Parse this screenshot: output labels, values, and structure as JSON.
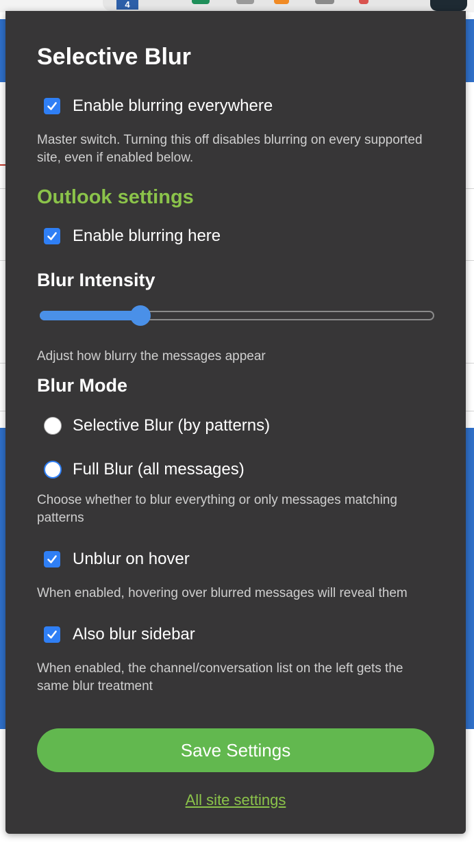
{
  "toolbar": {
    "badge_count": "4"
  },
  "popup": {
    "title": "Selective Blur",
    "global": {
      "enable_everywhere_label": "Enable blurring everywhere",
      "enable_everywhere_checked": true,
      "master_help": "Master switch. Turning this off disables blurring on every supported site, even if enabled below."
    },
    "site": {
      "section_title": "Outlook settings",
      "enable_here_label": "Enable blurring here",
      "enable_here_checked": true,
      "intensity_title": "Blur Intensity",
      "intensity_value": 0.23,
      "intensity_help": "Adjust how blurry the messages appear",
      "mode_title": "Blur Mode",
      "modes": [
        {
          "label": "Selective Blur (by patterns)",
          "selected": false
        },
        {
          "label": "Full Blur (all messages)",
          "selected": true
        }
      ],
      "mode_help": "Choose whether to blur everything or only messages matching patterns",
      "unblur_hover_label": "Unblur on hover",
      "unblur_hover_checked": true,
      "unblur_hover_help": "When enabled, hovering over blurred messages will reveal them",
      "blur_sidebar_label": "Also blur sidebar",
      "blur_sidebar_checked": true,
      "blur_sidebar_help": "When enabled, the channel/conversation list on the left gets the same blur treatment"
    },
    "save_label": "Save Settings",
    "all_sites_label": "All site settings"
  },
  "colors": {
    "popup_bg": "#373637",
    "accent_green": "#8bc34a",
    "button_green": "#62b84f",
    "control_blue": "#2f7ff5",
    "page_blue": "#2f6fc8"
  }
}
